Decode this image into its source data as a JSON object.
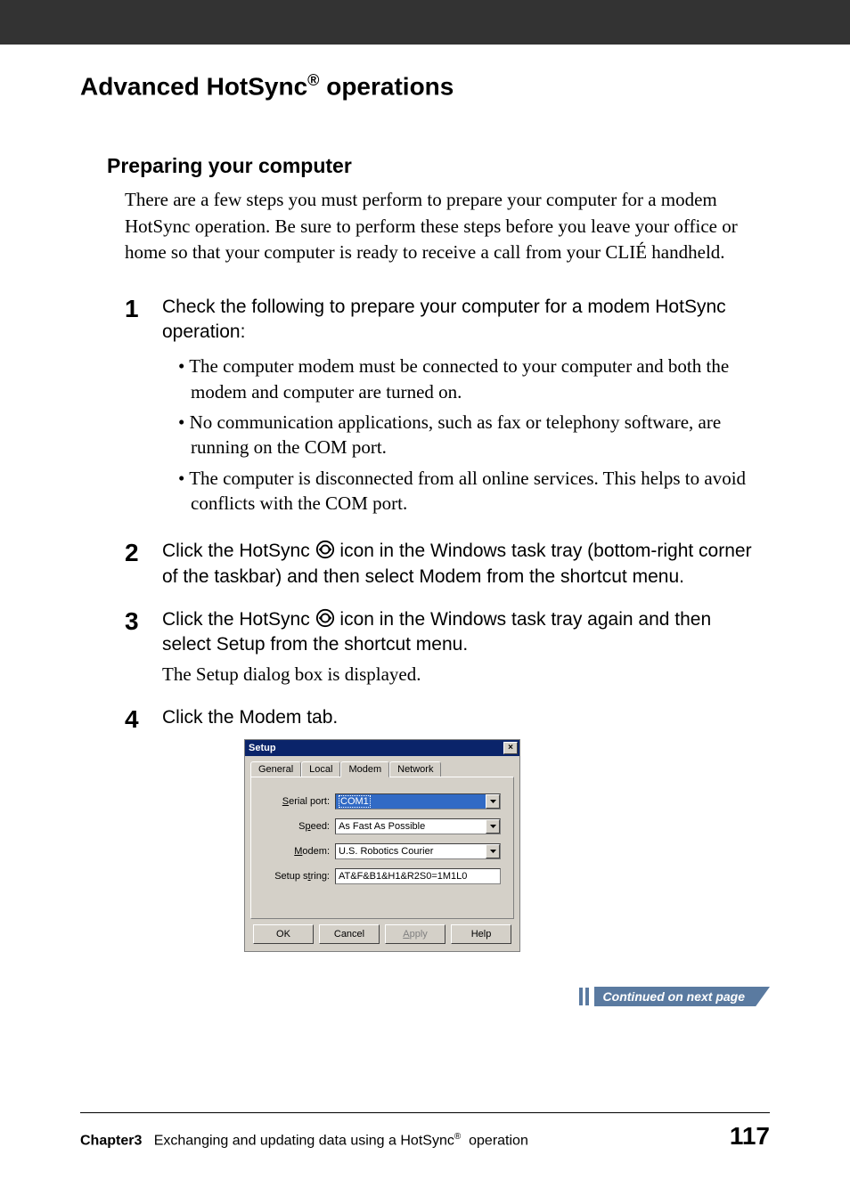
{
  "header": {
    "title_pre": "Advanced HotSync",
    "title_reg": "®",
    "title_post": " operations"
  },
  "section": {
    "heading": "Preparing your computer",
    "intro": "There are a few steps you must perform to prepare your computer for a modem HotSync operation. Be sure to perform these steps before you leave your office or home so that your computer is ready to receive a call from your CLIÉ handheld."
  },
  "steps": {
    "s1": {
      "num": "1",
      "text": "Check the following to prepare your computer for a modem HotSync operation:",
      "bullets": [
        "The computer modem must be connected to your computer and both the modem and computer are turned on.",
        "No communication applications, such as fax or telephony software, are running on the COM port.",
        "The computer is disconnected from all online services. This helps to avoid conflicts with the COM port."
      ]
    },
    "s2": {
      "num": "2",
      "text_pre": "Click the HotSync ",
      "text_post": " icon in the Windows task tray (bottom-right corner of the taskbar) and then select Modem from the shortcut menu."
    },
    "s3": {
      "num": "3",
      "text_pre": "Click the HotSync ",
      "text_post": " icon in the Windows task tray again and then select Setup from the shortcut menu.",
      "sub": "The Setup dialog box is displayed."
    },
    "s4": {
      "num": "4",
      "text": "Click the Modem tab."
    }
  },
  "dialog": {
    "title": "Setup",
    "tabs": {
      "t1": "General",
      "t2": "Local",
      "t3": "Modem",
      "t4": "Network"
    },
    "fields": {
      "serial_label_u": "S",
      "serial_label_rest": "erial port:",
      "serial_value": "COM1",
      "speed_label_u": "p",
      "speed_label_pre": "S",
      "speed_label_post": "eed:",
      "speed_value": "As Fast As Possible",
      "modem_label_u": "M",
      "modem_label_rest": "odem:",
      "modem_value": "U.S. Robotics Courier",
      "setup_label_pre": "Setup s",
      "setup_label_u": "t",
      "setup_label_post": "ring:",
      "setup_value": "AT&F&B1&H1&R2S0=1M1L0"
    },
    "buttons": {
      "ok": "OK",
      "cancel": "Cancel",
      "apply_u": "A",
      "apply_rest": "pply",
      "help": "Help"
    }
  },
  "continued": "Continued on next page",
  "footer": {
    "chapter_label": "Chapter3",
    "chapter_text_pre": "Exchanging and updating data using a HotSync",
    "reg": "®",
    "chapter_text_post": " operation",
    "page": "117"
  }
}
